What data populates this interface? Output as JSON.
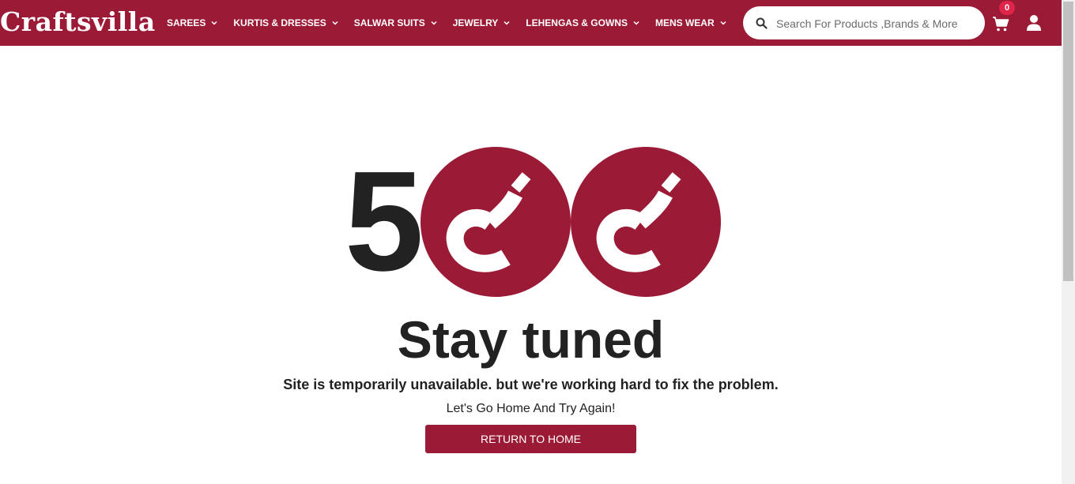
{
  "brand": {
    "logo_text": "Craftsvilla",
    "primary_color": "#9b1b37",
    "badge_color": "#e0244a"
  },
  "nav": {
    "items": [
      {
        "label": "SAREES"
      },
      {
        "label": "KURTIS & DRESSES"
      },
      {
        "label": "SALWAR SUITS"
      },
      {
        "label": "JEWELRY"
      },
      {
        "label": "LEHENGAS & GOWNS"
      },
      {
        "label": "MENS WEAR"
      }
    ]
  },
  "search": {
    "placeholder": "Search For Products ,Brands & More",
    "icon": "search-icon"
  },
  "cart": {
    "count": "0",
    "icon": "cart-icon"
  },
  "user": {
    "icon": "user-icon"
  },
  "error": {
    "code_digit": "5",
    "headline": "Stay tuned",
    "message": "Site is temporarily unavailable. but we're working hard to fix the problem.",
    "tagline": "Let's Go Home And Try Again!",
    "button_label": "RETURN TO HOME"
  }
}
